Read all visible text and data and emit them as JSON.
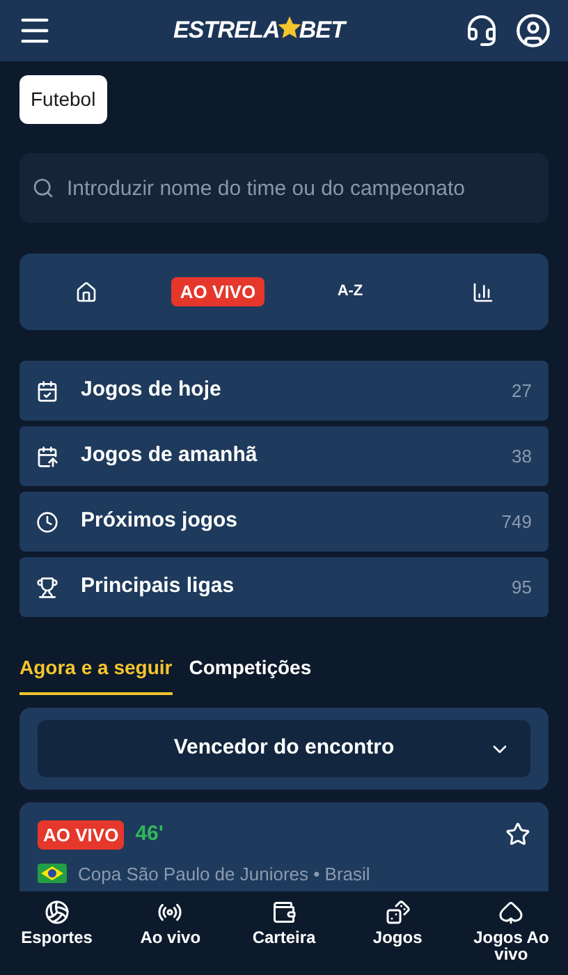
{
  "header": {
    "logo_left": "ESTRELA",
    "logo_right": "BET"
  },
  "sport_chip": "Futebol",
  "search": {
    "placeholder": "Introduzir nome do time ou do campeonato"
  },
  "filters": [
    {
      "kind": "home"
    },
    {
      "kind": "live",
      "label": "AO VIVO"
    },
    {
      "kind": "text",
      "label": "A-Z"
    },
    {
      "kind": "chart"
    }
  ],
  "menu": [
    {
      "label": "Jogos de hoje",
      "count": "27"
    },
    {
      "label": "Jogos de amanhã",
      "count": "38"
    },
    {
      "label": "Próximos jogos",
      "count": "749"
    },
    {
      "label": "Principais ligas",
      "count": "95"
    }
  ],
  "tabs": [
    {
      "label": "Agora e a seguir",
      "selected": true
    },
    {
      "label": "Competições",
      "selected": false
    }
  ],
  "market_select": {
    "value": "Vencedor do encontro"
  },
  "match": {
    "live_badge": "AO VIVO",
    "minute": "46'",
    "competition": "Copa São Paulo de Juniores • Brasil",
    "favorite": false
  },
  "bottom_nav": [
    {
      "label": "Esportes"
    },
    {
      "label": "Ao vivo"
    },
    {
      "label": "Carteira"
    },
    {
      "label": "Jogos"
    },
    {
      "label": "Jogos Ao vivo"
    }
  ]
}
